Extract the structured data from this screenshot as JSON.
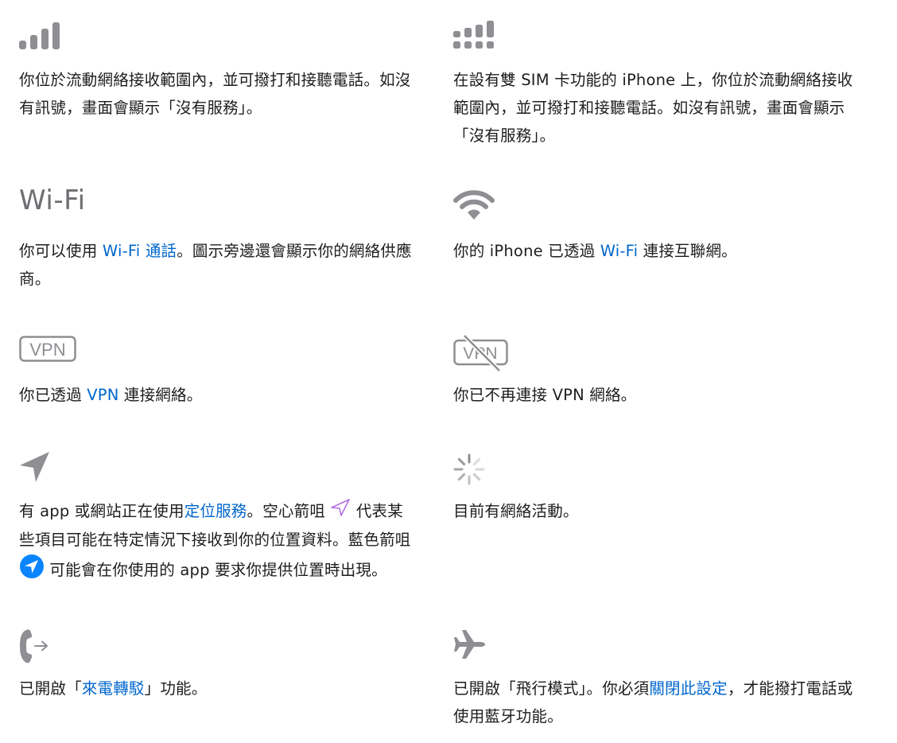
{
  "items": [
    {
      "icon": "cellular-signal-icon",
      "text": "你位於流動網絡接收範圍內，並可撥打和接聽電話。如沒有訊號，畫面會顯示「沒有服務」。"
    },
    {
      "icon": "dual-sim-signal-icon",
      "text": "在設有雙 SIM 卡功能的 iPhone 上，你位於流動網絡接收範圍內，並可撥打和接聽電話。如沒有訊號，畫面會顯示「沒有服務」。"
    },
    {
      "title": "Wi-Fi",
      "text_before": "你可以使用 ",
      "link": "Wi-Fi 通話",
      "text_after": "。圖示旁邊還會顯示你的網絡供應商。"
    },
    {
      "icon": "wifi-icon",
      "text_before": "你的 iPhone 已透過 ",
      "link": "Wi-Fi",
      "text_after": " 連接互聯網。"
    },
    {
      "icon": "vpn-icon",
      "icon_label": "VPN",
      "text_before": "你已透過 ",
      "link": "VPN",
      "text_after": " 連接網絡。"
    },
    {
      "icon": "vpn-disconnected-icon",
      "icon_label": "VPN",
      "text": "你已不再連接 VPN 網絡。"
    },
    {
      "icon": "location-arrow-icon",
      "text_1": "有 app 或網站正在使用",
      "link": "定位服務",
      "text_2": "。空心箭咀 ",
      "text_3": " 代表某些項目可能在特定情況下接收到你的位置資料。藍色箭咀 ",
      "text_4": " 可能會在你使用的 app 要求你提供位置時出現。"
    },
    {
      "icon": "network-activity-icon",
      "text": "目前有網絡活動。"
    },
    {
      "icon": "call-forwarding-icon",
      "text_before": "已開啟「",
      "link": "來電轉駁",
      "text_after": "」功能。"
    },
    {
      "icon": "airplane-icon",
      "text_before": "已開啟「飛行模式」。你必須",
      "link": "關閉此設定",
      "text_after": "，才能撥打電話或使用藍牙功能。"
    }
  ],
  "colors": {
    "text": "#1d1d1f",
    "link": "#0066cc",
    "icon_gray": "#8e8e93",
    "purple": "#b26fe0",
    "blue": "#0a84ff"
  }
}
